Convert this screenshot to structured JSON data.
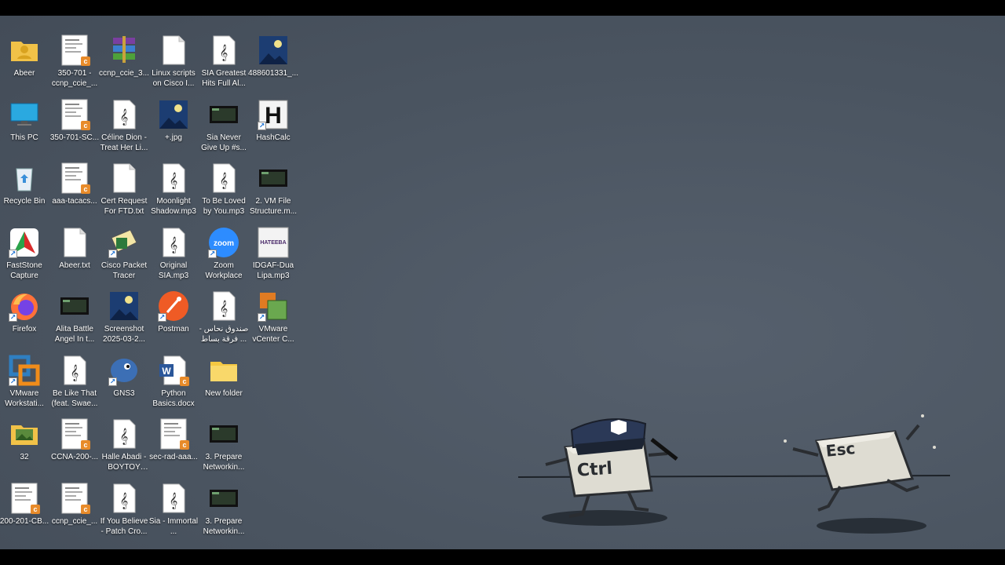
{
  "desktop": {
    "icons": [
      {
        "label": "Abeer",
        "icon": "user-folder-icon"
      },
      {
        "label": "350-701 - ccnp_ccie_...",
        "icon": "document-icon"
      },
      {
        "label": "ccnp_ccie_3...",
        "icon": "winrar-archive-icon"
      },
      {
        "label": "Linux scripts on Cisco I...",
        "icon": "text-file-icon"
      },
      {
        "label": "SIA Greatest Hits Full Al...",
        "icon": "mp3-file-icon"
      },
      {
        "label": "488601331_...",
        "icon": "image-file-icon"
      },
      {
        "label": "This PC",
        "icon": "monitor-icon"
      },
      {
        "label": "350-701-SC...",
        "icon": "document-icon"
      },
      {
        "label": "Céline Dion - Treat Her Li...",
        "icon": "mp3-file-icon"
      },
      {
        "label": "+.jpg",
        "icon": "image-file-icon"
      },
      {
        "label": "Sia Never Give Up #s...",
        "icon": "video-file-icon"
      },
      {
        "label": "HashCalc",
        "icon": "hashcalc-icon"
      },
      {
        "label": "Recycle Bin",
        "icon": "recycle-bin-icon"
      },
      {
        "label": "aaa-tacacs...",
        "icon": "document-icon"
      },
      {
        "label": "Cert Request For FTD.txt",
        "icon": "text-file-icon"
      },
      {
        "label": "Moonlight Shadow.mp3",
        "icon": "mp3-file-icon"
      },
      {
        "label": "To Be Loved by You.mp3",
        "icon": "mp3-file-icon"
      },
      {
        "label": "2. VM File Structure.m...",
        "icon": "video-file-icon"
      },
      {
        "label": "FastStone Capture",
        "icon": "faststone-icon"
      },
      {
        "label": "Abeer.txt",
        "icon": "text-file-icon"
      },
      {
        "label": "Cisco Packet Tracer",
        "icon": "packet-tracer-icon"
      },
      {
        "label": "Original SIA.mp3",
        "icon": "mp3-file-icon"
      },
      {
        "label": "Zoom Workplace",
        "icon": "zoom-icon"
      },
      {
        "label": "IDGAF-Dua Lipa.mp3",
        "icon": "mp3-cover-icon"
      },
      {
        "label": "Firefox",
        "icon": "firefox-icon"
      },
      {
        "label": "Alita Battle Angel In t...",
        "icon": "video-file-icon"
      },
      {
        "label": "Screenshot 2025-03-2...",
        "icon": "image-file-icon"
      },
      {
        "label": "Postman",
        "icon": "postman-icon"
      },
      {
        "label": "صندوق نحاس - فرقة بساط ...",
        "icon": "mp3-file-icon"
      },
      {
        "label": "VMware vCenter C...",
        "icon": "vmware-vcenter-icon"
      },
      {
        "label": "VMware Workstati...",
        "icon": "vmware-workstation-icon"
      },
      {
        "label": "Be Like That (feat. Swae...",
        "icon": "mp3-file-icon"
      },
      {
        "label": "GNS3",
        "icon": "gns3-icon"
      },
      {
        "label": "Python Basics.docx",
        "icon": "word-doc-icon"
      },
      {
        "label": "New folder",
        "icon": "folder-icon"
      },
      {
        "label": "32",
        "icon": "image-folder-icon"
      },
      {
        "label": "CCNA-200-...",
        "icon": "document-icon"
      },
      {
        "label": "Halle Abadi - BOYTOY (Ly...",
        "icon": "mp3-file-icon"
      },
      {
        "label": "sec-rad-aaa...",
        "icon": "document-icon"
      },
      {
        "label": "3. Prepare Networkin...",
        "icon": "video-file-icon"
      },
      {
        "label": "200-201-CB...",
        "icon": "document-icon"
      },
      {
        "label": "ccnp_ccie_...",
        "icon": "document-icon"
      },
      {
        "label": "If You Believe - Patch Cro...",
        "icon": "mp3-file-icon"
      },
      {
        "label": "Sia - Immortal ...",
        "icon": "mp3-file-icon"
      },
      {
        "label": "3. Prepare Networkin...",
        "icon": "video-file-icon"
      }
    ],
    "wallpaper": {
      "key_left": "Ctrl",
      "key_right": "Esc"
    }
  }
}
